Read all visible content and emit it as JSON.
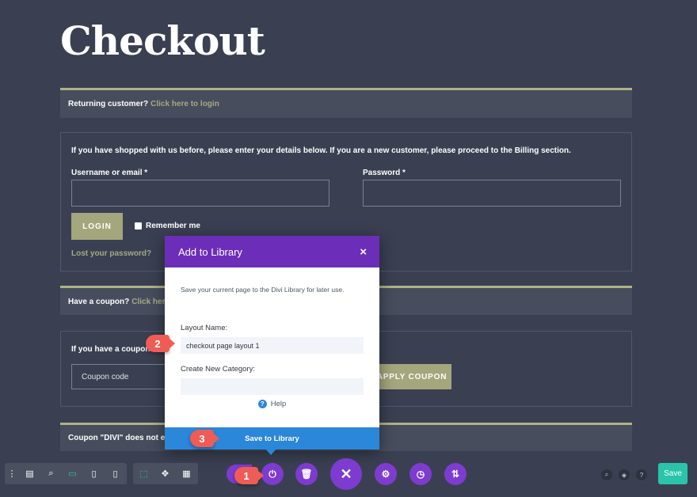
{
  "page": {
    "title": "Checkout"
  },
  "returning": {
    "text": "Returning customer?",
    "link": "Click here to login"
  },
  "login_form": {
    "intro": "If you have shopped with us before, please enter your details below. If you are a new customer, please proceed to the Billing section.",
    "username_label": "Username or email *",
    "password_label": "Password *",
    "login_button": "LOGIN",
    "remember_label": "Remember me",
    "lost_password": "Lost your password?"
  },
  "coupon_notice": {
    "text": "Have a coupon?",
    "link": "Click here to"
  },
  "coupon_form": {
    "intro": "If you have a coupon co",
    "placeholder": "Coupon code",
    "apply_button": "APPLY COUPON"
  },
  "coupon_status": {
    "text": "Coupon \"DIVI\" does not exist"
  },
  "modal": {
    "title": "Add to Library",
    "close_icon": "×",
    "description": "Save your current page to the Divi Library for later use.",
    "layout_name_label": "Layout Name:",
    "layout_name_value": "checkout page layout 1",
    "category_label": "Create New Category:",
    "category_value": "",
    "help_label": "Help",
    "save_button": "Save to Library"
  },
  "steps": [
    "1",
    "2",
    "3"
  ],
  "toolbar": {
    "save_label": "Save",
    "accent": "#7e3bd0",
    "save_color": "#29c4a9"
  }
}
